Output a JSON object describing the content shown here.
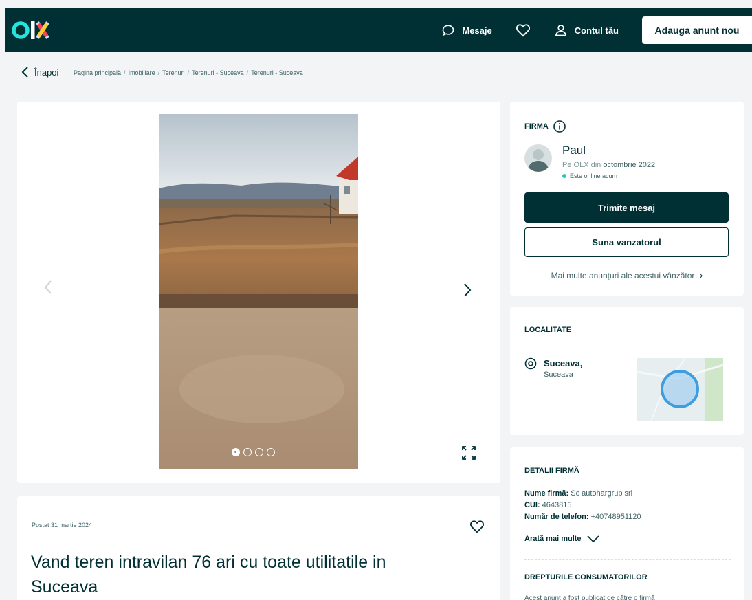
{
  "header": {
    "logo": "OLX",
    "nav": {
      "messages": "Mesaje",
      "account": "Contul tău",
      "post_ad": "Adauga anunt nou"
    }
  },
  "breadcrumb": {
    "back": "Înapoi",
    "items": [
      "Pagina principală",
      "Imobiliare",
      "Terenuri",
      "Terenuri - Suceava",
      "Terenuri - Suceava"
    ]
  },
  "gallery": {
    "image_count": 4,
    "active_index": 0
  },
  "listing": {
    "posted": "Postat 31 martie 2024",
    "title": "Vand teren intravilan 76 ari cu toate utilitatile in Suceava"
  },
  "seller": {
    "section_label": "FIRMA",
    "name": "Paul",
    "since_prefix": "Pe OLX din",
    "since_date": "octombrie 2022",
    "online": "Este online acum",
    "message_button": "Trimite mesaj",
    "call_button": "Suna vanzatorul",
    "more_ads": "Mai multe anunțuri ale acestui vânzător",
    "more_ads_chevron": "›"
  },
  "location": {
    "section_label": "LOCALITATE",
    "city": "Suceava,",
    "region": "Suceava"
  },
  "company": {
    "section_label": "DETALII FIRMĂ",
    "name_label": "Nume firmă:",
    "name_value": "Sc autohargrup srl",
    "cui_label": "CUI:",
    "cui_value": "4643815",
    "phone_label": "Număr de telefon:",
    "phone_value": "+40748951120",
    "show_more": "Arată mai multe",
    "consumer_rights": "DREPTURILE CONSUMATORILOR",
    "consumer_note": "Acest anunț a fost publicat de către o firmă"
  },
  "colors": {
    "header_bg": "#002f34",
    "primary": "#002f34",
    "accent": "#23e5db",
    "page_bg": "#f2f4f5"
  }
}
